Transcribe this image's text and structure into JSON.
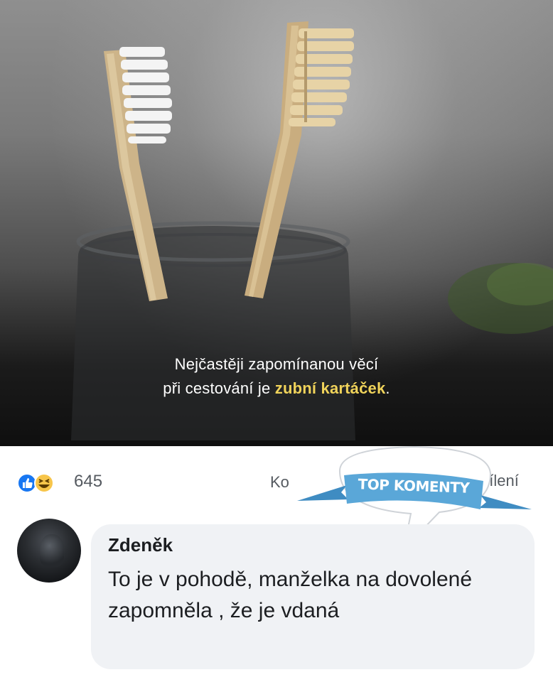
{
  "post": {
    "image_caption_line1": "Nejčastěji zapomínanou věcí",
    "image_caption_line2_pre": "při cestování je ",
    "image_caption_line2_highlight": "zubní kartáček",
    "image_caption_line2_post": "."
  },
  "reactions": {
    "icons": [
      "like-icon",
      "haha-icon"
    ],
    "count": "645",
    "comments_label": "Ko",
    "shares_label": "dílení"
  },
  "badge": {
    "label": "TOP KOMENTY",
    "color": "#5aa7d8"
  },
  "comment": {
    "author": "Zdeněk",
    "text": "To je v pohodě, manželka na dovolené zapomněla , že je vdaná"
  },
  "colors": {
    "caption_highlight": "#f0d35a",
    "comment_bg": "#f0f2f5",
    "like_blue": "#1877f2",
    "haha_yellow": "#f7c54a"
  }
}
